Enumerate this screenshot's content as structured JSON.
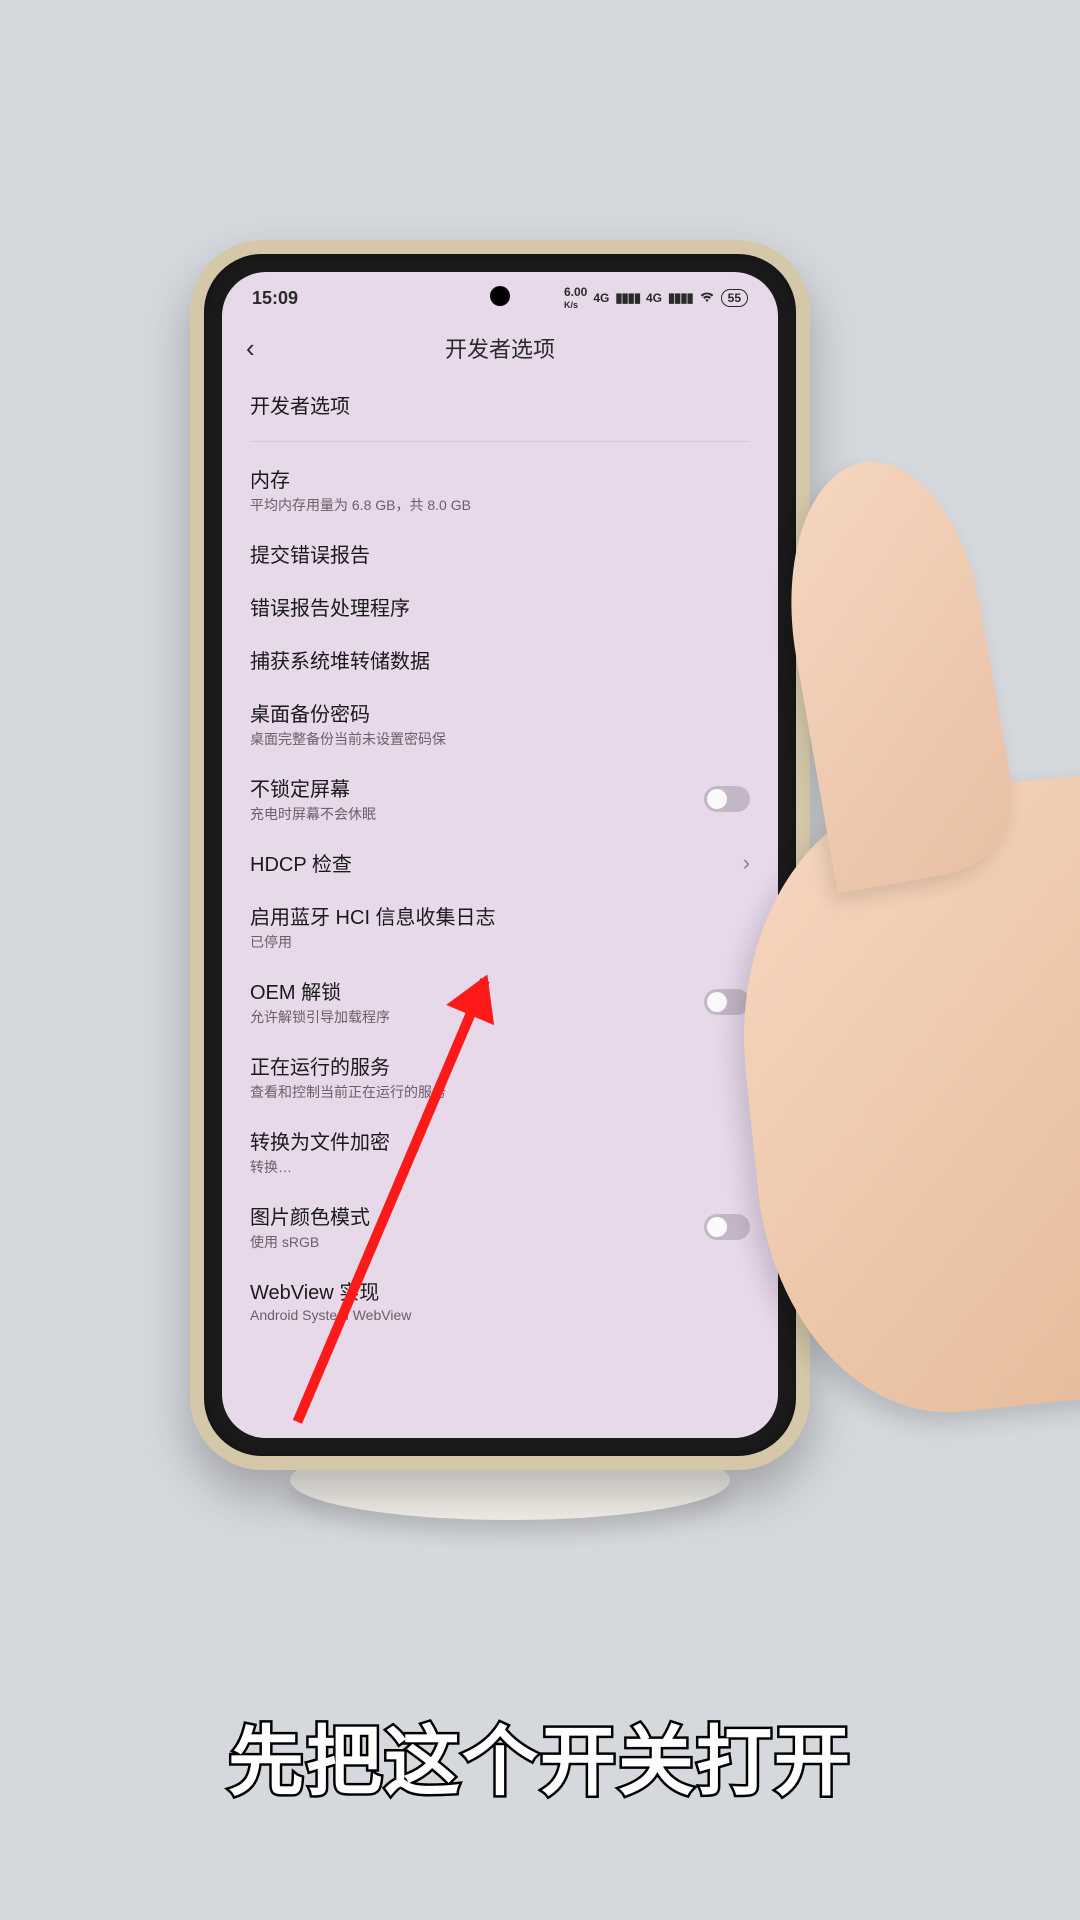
{
  "status": {
    "time": "15:09",
    "carrier_small": "6.00",
    "carrier_sub": "K/s",
    "net1": "4G",
    "net2": "4G",
    "battery": "55"
  },
  "header": {
    "back": "‹",
    "title": "开发者选项"
  },
  "master": {
    "title": "开发者选项"
  },
  "items": {
    "memory": {
      "title": "内存",
      "sub": "平均内存用量为 6.8 GB，共 8.0 GB"
    },
    "bug_report": {
      "title": "提交错误报告"
    },
    "bug_handler": {
      "title": "错误报告处理程序"
    },
    "heap_dump": {
      "title": "捕获系统堆转储数据"
    },
    "backup_pw": {
      "title": "桌面备份密码",
      "sub": "桌面完整备份当前未设置密码保"
    },
    "stay_awake": {
      "title": "不锁定屏幕",
      "sub": "充电时屏幕不会休眠"
    },
    "hdcp": {
      "title": "HDCP 检查"
    },
    "bt_hci": {
      "title": "启用蓝牙 HCI 信息收集日志",
      "sub": "已停用"
    },
    "oem": {
      "title": "OEM 解锁",
      "sub": "允许解锁引导加载程序"
    },
    "running": {
      "title": "正在运行的服务",
      "sub": "查看和控制当前正在运行的服务"
    },
    "file_enc": {
      "title": "转换为文件加密",
      "sub": "转换…"
    },
    "color_mode": {
      "title": "图片颜色模式",
      "sub": "使用 sRGB"
    },
    "webview": {
      "title": "WebView 实现",
      "sub": "Android System WebView"
    }
  },
  "caption": "先把这个开关打开"
}
